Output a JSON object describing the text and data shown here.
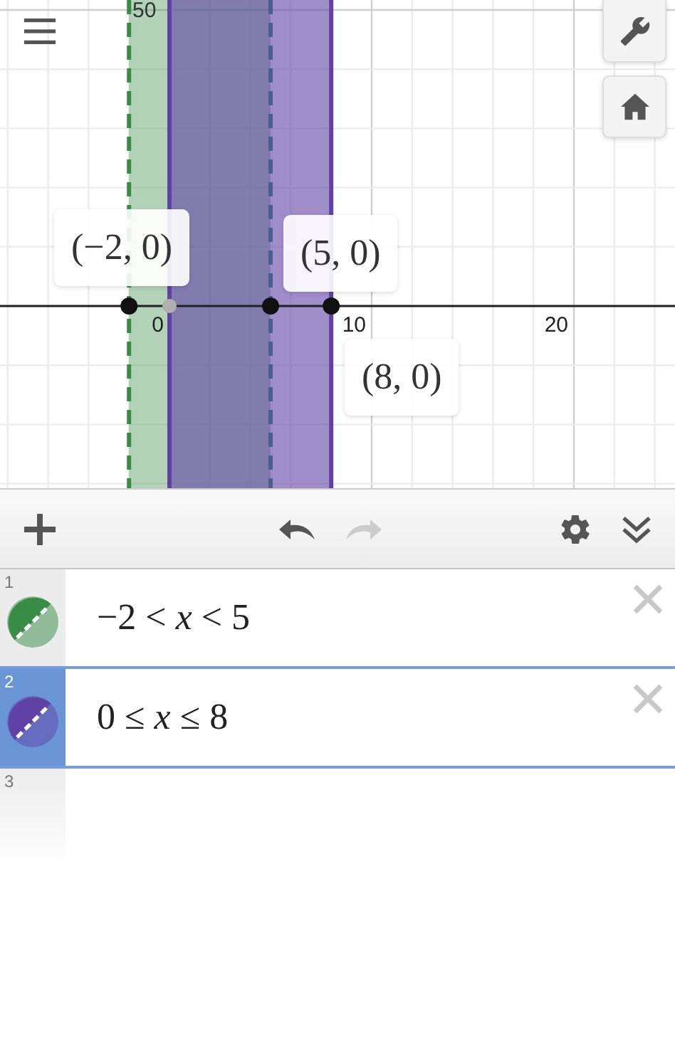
{
  "graph": {
    "y_tick_labels": [
      "50"
    ],
    "x_tick_labels": [
      "0",
      "10",
      "20"
    ],
    "point_labels": [
      "(−2, 0)",
      "(5, 0)",
      "(8, 0)"
    ]
  },
  "toolbar": {
    "undo": {
      "disabled": false
    },
    "redo": {
      "disabled": true
    }
  },
  "expressions": [
    {
      "number": "1",
      "latex": "−2 < *x* < 5",
      "color": "#388c46",
      "selected": false
    },
    {
      "number": "2",
      "latex": "0 ≤ *x* ≤ 8",
      "color": "#6042a6",
      "selected": true
    },
    {
      "number": "3",
      "selected": false
    }
  ]
}
